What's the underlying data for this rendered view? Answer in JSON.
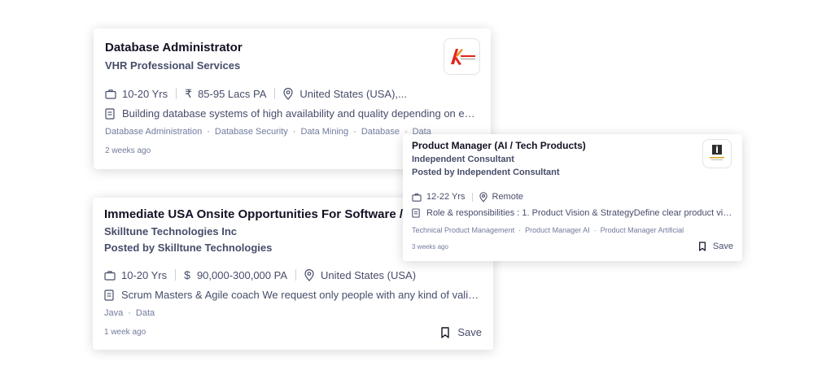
{
  "cards": [
    {
      "title": "Database Administrator",
      "company": "VHR Professional Services",
      "logo_icon": "vhr-logo-icon",
      "experience": "10-20 Yrs",
      "salary": "85-95 Lacs PA",
      "location": "United States (USA),...",
      "description": "Building database systems of high availability and quality depending on end...",
      "tags": [
        "Database Administration",
        "Database Security",
        "Data Mining",
        "Database",
        "Data"
      ],
      "posted_ago": "2 weeks ago"
    },
    {
      "title": "Immediate USA Onsite Opportunities For Software /IT p",
      "company": "Skilltune Technologies Inc",
      "posted_by": "Posted by Skilltune Technologies",
      "experience": "10-20 Yrs",
      "salary": "90,000-300,000 PA",
      "location": "United States (USA)",
      "description": "Scrum Masters & Agile coach We request only people with any kind of valid ...",
      "tags": [
        "Java",
        "Data"
      ],
      "posted_ago": "1 week ago",
      "save_label": "Save"
    },
    {
      "title": "Product Manager (AI / Tech Products)",
      "company": "Independent Consultant",
      "posted_by": "Posted by Independent Consultant",
      "logo_icon": "independent-consultant-logo-icon",
      "experience": "12-22 Yrs",
      "location": "Remote",
      "description": "Role & responsibilities : 1. Product Vision & StrategyDefine clear product visi...",
      "tags": [
        "Technical Product Management",
        "Product Manager AI",
        "Product Manager Artificial"
      ],
      "posted_ago": "3 weeks ago",
      "save_label": "Save"
    }
  ],
  "colors": {
    "title": "#121224",
    "subtext": "#474d6a",
    "muted": "#717b9e",
    "vhr_red": "#e1251b"
  }
}
